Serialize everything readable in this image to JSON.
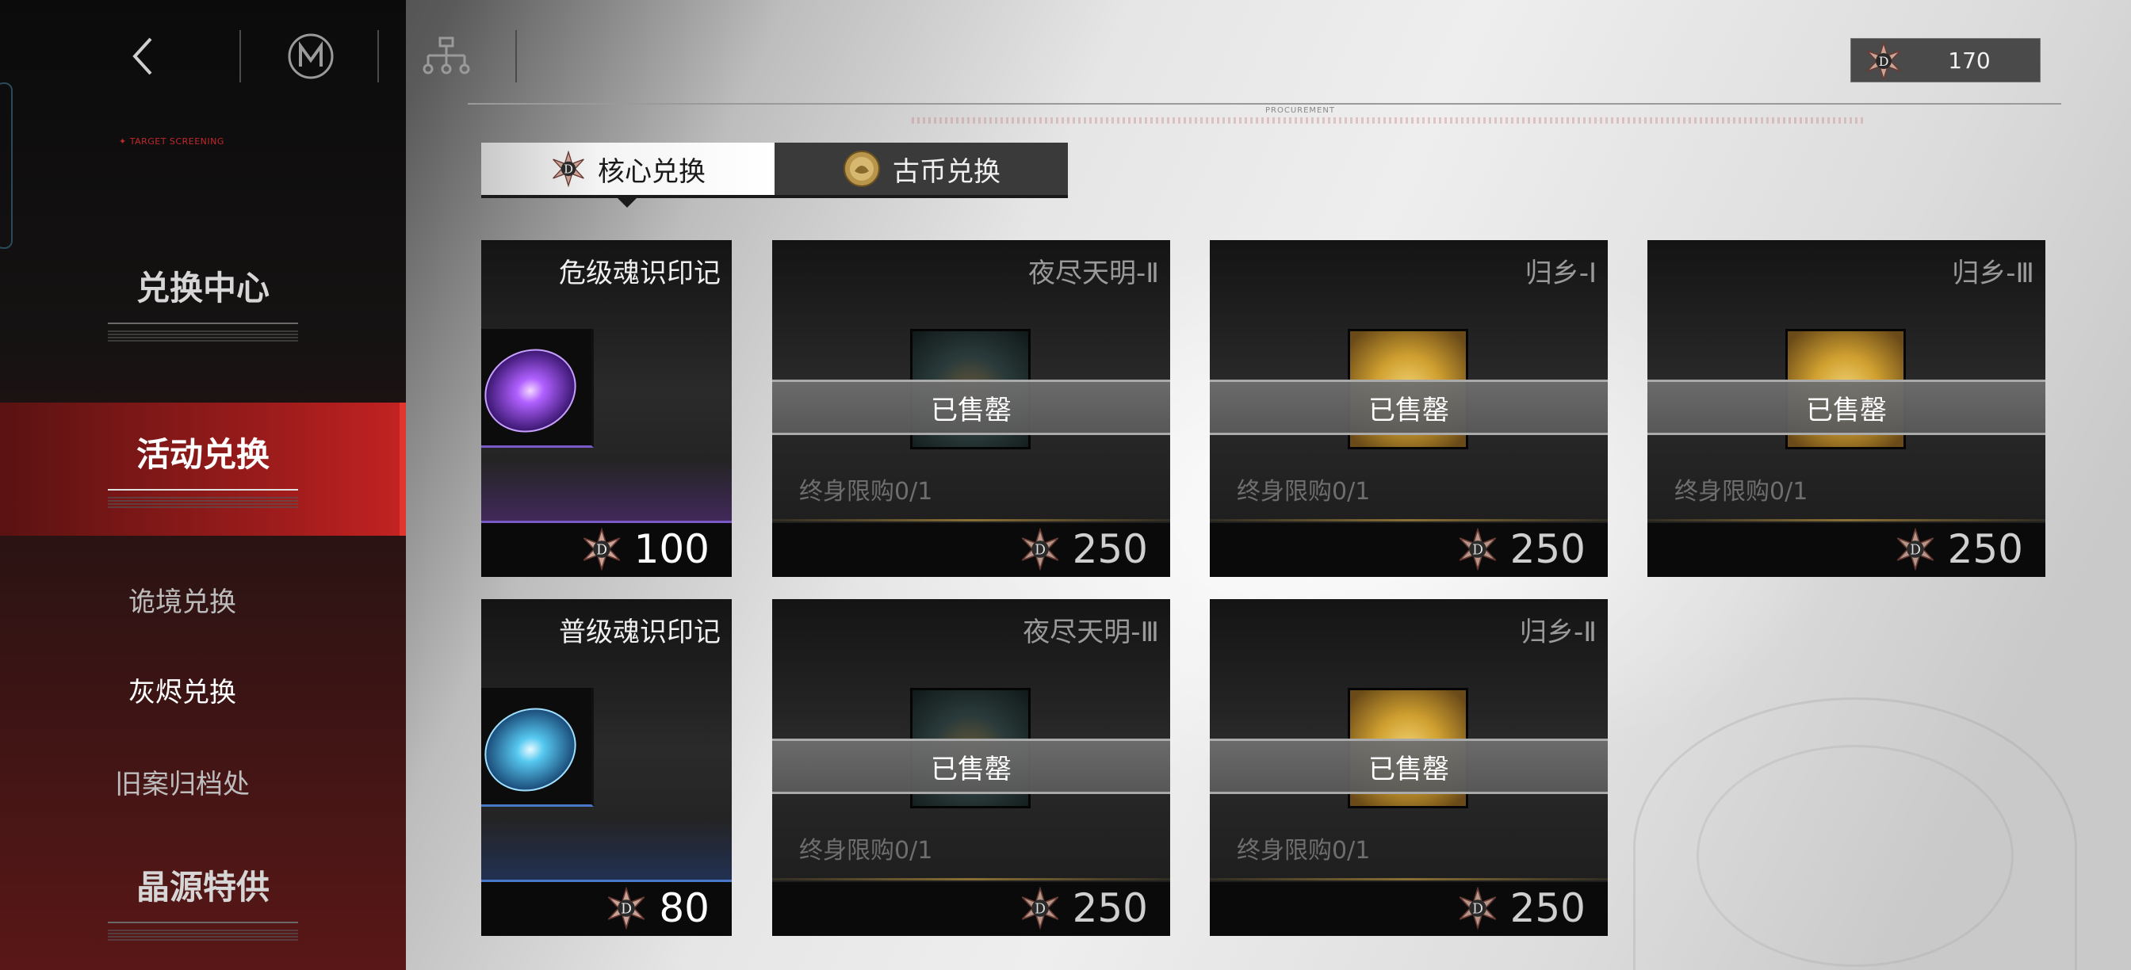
{
  "header": {
    "currency_value": "170",
    "section_caption": "PROCUREMENT"
  },
  "sidebar": {
    "tag": "✦ TARGET SCREENING",
    "items": [
      {
        "label": "兑换中心"
      },
      {
        "label": "活动兑换"
      },
      {
        "label": "诡境兑换"
      },
      {
        "label": "灰烬兑换"
      },
      {
        "label": "旧案归档处"
      },
      {
        "label": "晶源特供"
      }
    ]
  },
  "tabs": [
    {
      "label": "核心兑换"
    },
    {
      "label": "古币兑换"
    }
  ],
  "cards": [
    {
      "title": "危级魂识印记",
      "price": "100"
    },
    {
      "title": "夜尽天明-Ⅱ",
      "status": "已售罄",
      "limit": "终身限购0/1",
      "price": "250"
    },
    {
      "title": "归乡-Ⅰ",
      "status": "已售罄",
      "limit": "终身限购0/1",
      "price": "250"
    },
    {
      "title": "归乡-Ⅲ",
      "status": "已售罄",
      "limit": "终身限购0/1",
      "price": "250"
    },
    {
      "title": "普级魂识印记",
      "price": "80"
    },
    {
      "title": "夜尽天明-Ⅲ",
      "status": "已售罄",
      "limit": "终身限购0/1",
      "price": "250"
    },
    {
      "title": "归乡-Ⅱ",
      "status": "已售罄",
      "limit": "终身限购0/1",
      "price": "250"
    }
  ],
  "colors": {
    "accent_red": "#c42222",
    "sidebar_dark": "#0b0b0b",
    "card_dark": "#1a1a1a"
  }
}
